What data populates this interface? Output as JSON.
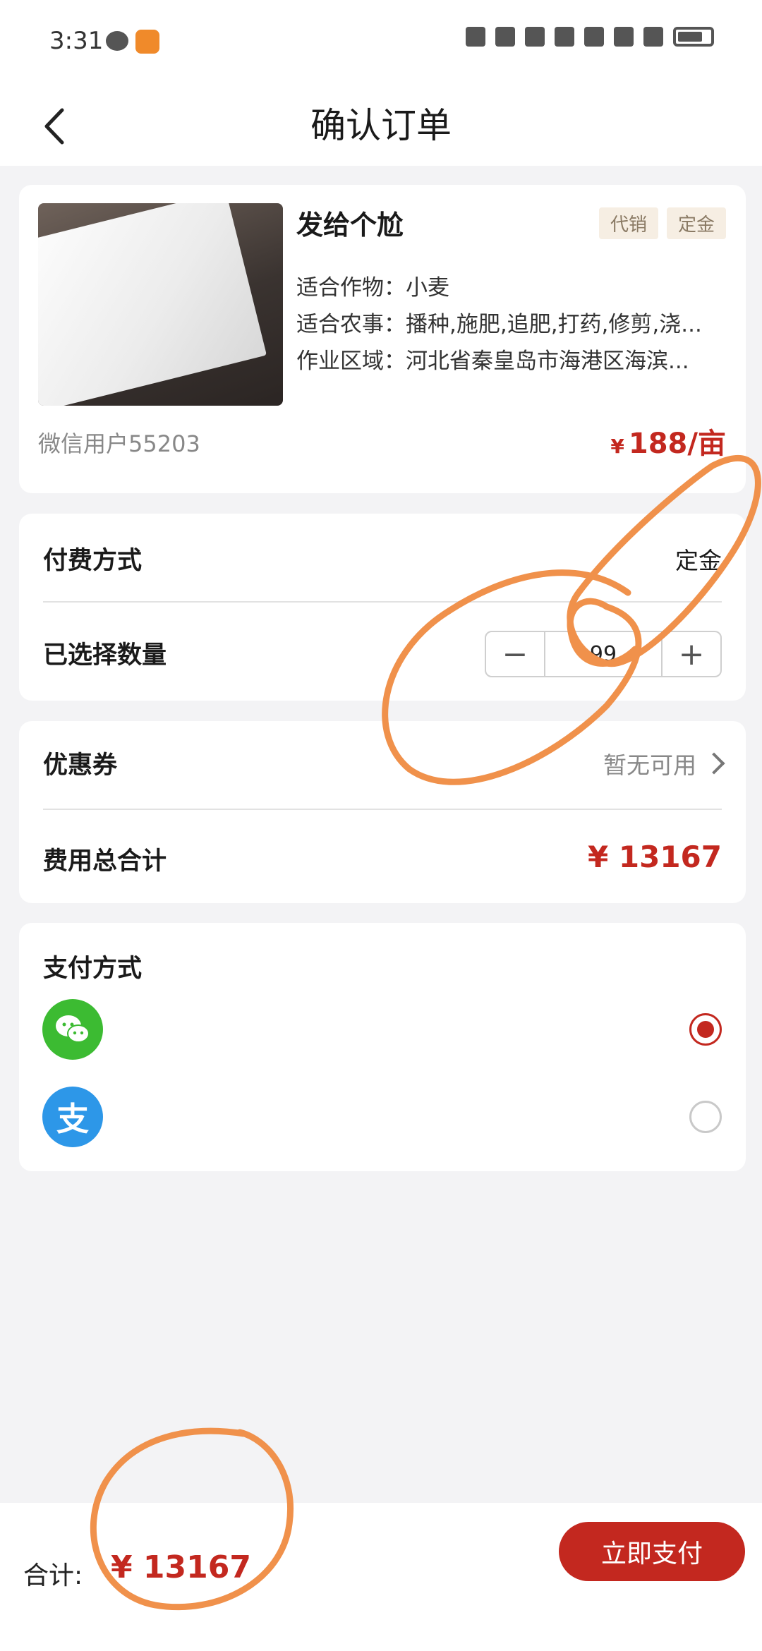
{
  "status_bar": {
    "time": "3:31"
  },
  "navbar": {
    "title": "确认订单"
  },
  "product": {
    "name": "发给个尬",
    "tags": [
      "代销",
      "定金"
    ],
    "crop_label": "适合作物：",
    "crop_value": "小麦",
    "task_label": "适合农事：",
    "task_value": "播种,施肥,追肥,打药,修剪,浇...",
    "area_label": "作业区域：",
    "area_value": "河北省秦皇岛市海港区海滨...",
    "seller": "微信用户55203",
    "price_symbol": "¥",
    "price": "188/亩"
  },
  "order": {
    "payment_type_label": "付费方式",
    "payment_type_value": "定金",
    "quantity_label": "已选择数量",
    "quantity_minus": "−",
    "quantity_value": "99",
    "quantity_plus": "+"
  },
  "coupon": {
    "label": "优惠券",
    "value": "暂无可用",
    "total_label": "费用总合计",
    "total_value": "¥ 13167"
  },
  "payment": {
    "title": "支付方式",
    "methods": [
      {
        "icon": "wechat-pay-icon",
        "selected": true
      },
      {
        "icon": "alipay-icon",
        "glyph": "支",
        "selected": false
      }
    ]
  },
  "footer": {
    "sum_label": "合计:",
    "sum_value": "¥ 13167",
    "pay_button": "立即支付"
  },
  "colors": {
    "accent": "#c3281f",
    "annotation": "#f0914b",
    "wechat": "#3cbb32",
    "alipay": "#2d97e8"
  }
}
